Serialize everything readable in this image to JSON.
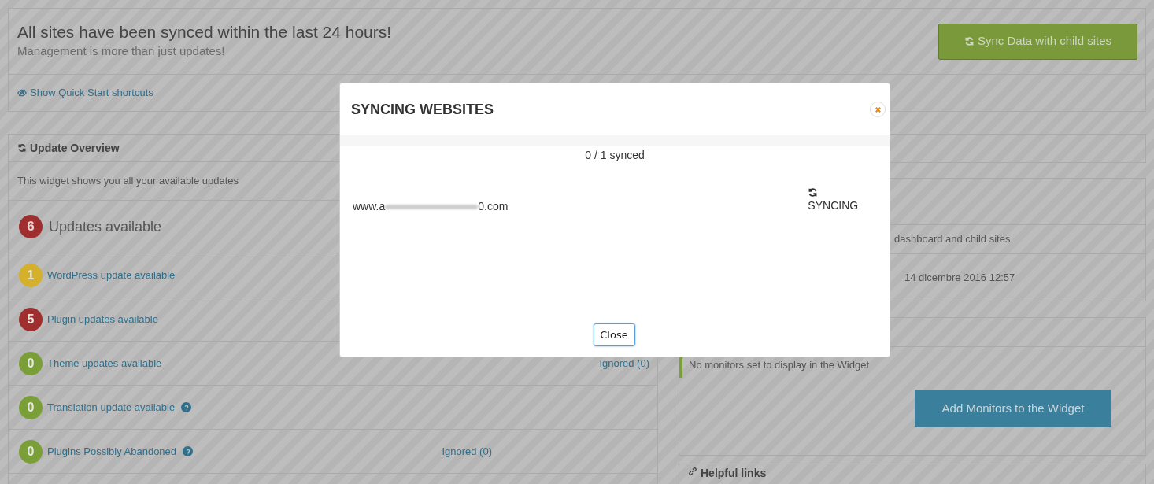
{
  "header": {
    "title": "All sites have been synced within the last 24 hours!",
    "subtitle": "Management is more than just updates!",
    "sync_button": "Sync Data with child sites"
  },
  "quick_start": {
    "label": "Show Quick Start shortcuts"
  },
  "update_overview": {
    "title": "Update Overview",
    "description": "This widget shows you all your available updates",
    "total": {
      "count": "6",
      "label": "Updates available",
      "color": "#9f2f2f"
    },
    "rows": [
      {
        "count": "1",
        "label": "WordPress update available",
        "color": "#d4b02c",
        "help": false
      },
      {
        "count": "5",
        "label": "Plugin updates available",
        "color": "#9f2f2f",
        "help": false
      },
      {
        "count": "0",
        "label": "Theme updates available",
        "color": "#7a9e38",
        "help": false,
        "ignored": "Ignored (0)"
      },
      {
        "count": "0",
        "label": "Translation update available",
        "color": "#7a9e38",
        "help": true
      },
      {
        "count": "0",
        "label": "Plugins Possibly Abandoned",
        "color": "#7a9e38",
        "help": true,
        "ignored": "Ignored (0)"
      }
    ]
  },
  "right_column": {
    "sync_info": "dashboard and child sites",
    "last_sync": "14 dicembre 2016 12:57",
    "monitors_note": "No monitors set to display in the Widget",
    "add_monitors_button": "Add Monitors to the Widget",
    "helpful_links_title": "Helpful links"
  },
  "modal": {
    "title": "SYNCING WEBSITES",
    "progress": "0 / 1 synced",
    "sites": [
      {
        "url_start": "www.a",
        "url_end": "0.com",
        "status": "SYNCING"
      }
    ],
    "close_button": "Close"
  }
}
